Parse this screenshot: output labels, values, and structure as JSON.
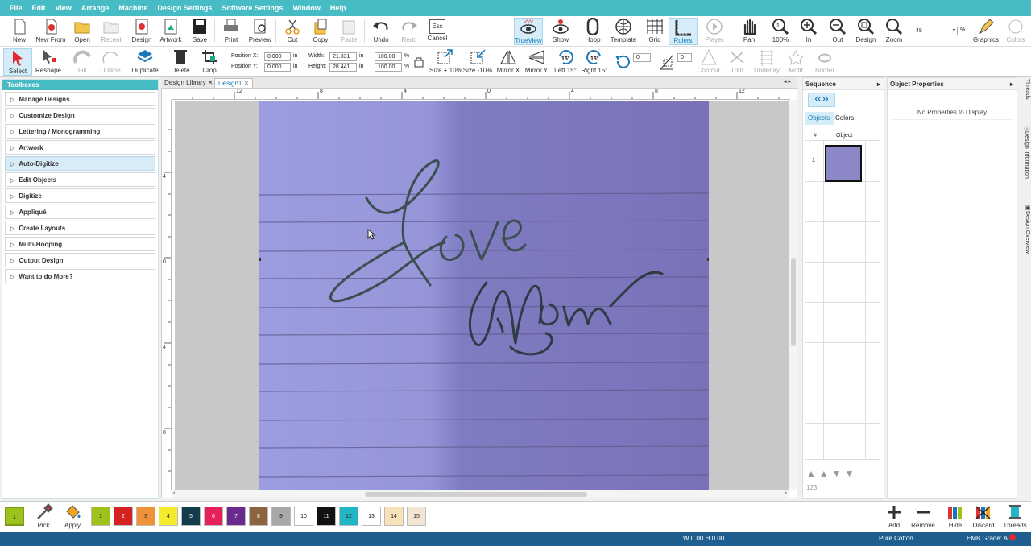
{
  "menu": [
    "File",
    "Edit",
    "View",
    "Arrange",
    "Machine",
    "Design Settings",
    "Software Settings",
    "Window",
    "Help"
  ],
  "toolbar1": {
    "new": "New",
    "new_from": "New From",
    "open": "Open",
    "recent": "Recent",
    "design": "Design",
    "artwork": "Artwork",
    "save": "Save",
    "print": "Print",
    "preview": "Preview",
    "cut": "Cut",
    "copy": "Copy",
    "paste": "Paste",
    "undo": "Undo",
    "redo": "Redo",
    "cancel": "Cancel",
    "esc": "Esc",
    "trueview": "TrueView",
    "show": "Show",
    "hoop": "Hoop",
    "template": "Template",
    "grid": "Grid",
    "rulers": "Rulers",
    "player": "Player",
    "pan": "Pan",
    "zoom100": "100%",
    "zoom_in": "In",
    "zoom_out": "Out",
    "zoom_design": "Design",
    "zoom": "Zoom",
    "zoom_value": "48",
    "percent": "%",
    "graphics": "Graphics",
    "colors": "Colors"
  },
  "toolbar2": {
    "select": "Select",
    "reshape": "Reshape",
    "fill": "Fill",
    "outline": "Outline",
    "duplicate": "Duplicate",
    "delete": "Delete",
    "crop": "Crop",
    "pos_x_label": "Position X:",
    "pos_x": "0.000",
    "pos_y_label": "Position Y:",
    "pos_y": "0.000",
    "unit": "in",
    "width_label": "Width:",
    "width": "21.331",
    "height_label": "Height:",
    "height": "28.441",
    "scale_w": "100.00",
    "scale_h": "100.00",
    "pct": "%",
    "size_plus": "Size + 10%",
    "size_minus": "Size -10%",
    "mirror_x": "Mirror X",
    "mirror_y": "Mirror Y",
    "left15": "Left 15°",
    "right15": "Right 15°",
    "deg": "15°",
    "rotate_val": "0",
    "slant_val": "0",
    "contour": "Contour",
    "trim": "Trim",
    "underlay": "Underlay",
    "motif": "Motif",
    "border": "Border"
  },
  "toolboxes": {
    "title": "Toolboxes",
    "items": [
      "Manage Designs",
      "Customize Design",
      "Lettering / Monogramming",
      "Artwork",
      "Auto-Digitize",
      "Edit Objects",
      "Digitize",
      "Appliqué",
      "Create Layouts",
      "Multi-Hooping",
      "Output Design",
      "Want to do More?"
    ]
  },
  "tabs": {
    "library": "Design Library",
    "design1": "Design1"
  },
  "rulers": {
    "h": [
      "12",
      "8",
      "4",
      "0",
      "4",
      "8",
      "12"
    ],
    "v": [
      "4",
      "0",
      "4",
      "8"
    ]
  },
  "handwriting": {
    "line1": "Love",
    "line2": "Mom"
  },
  "sequence": {
    "title": "Sequence",
    "tab_objects": "Objects",
    "tab_colors": "Colors",
    "col_num": "#",
    "col_object": "Object",
    "row1": "1",
    "footer": "123"
  },
  "object_properties": {
    "title": "Object Properties",
    "empty": "No Properties to Display"
  },
  "side_tabs": {
    "threads": "Threads",
    "design_info": "Design Information",
    "design_overview": "Design Overview"
  },
  "palette": {
    "pick": "Pick",
    "apply": "Apply",
    "current": "1",
    "swatches": [
      {
        "n": "1",
        "c": "#9dc11d"
      },
      {
        "n": "2",
        "c": "#d42121"
      },
      {
        "n": "3",
        "c": "#f0923a"
      },
      {
        "n": "4",
        "c": "#f2ec2c"
      },
      {
        "n": "5",
        "c": "#143b4c"
      },
      {
        "n": "6",
        "c": "#e8205a"
      },
      {
        "n": "7",
        "c": "#6a2b8f"
      },
      {
        "n": "8",
        "c": "#8c6440"
      },
      {
        "n": "9",
        "c": "#a8a8a8"
      },
      {
        "n": "10",
        "c": "#ffffff"
      },
      {
        "n": "11",
        "c": "#111111"
      },
      {
        "n": "12",
        "c": "#22b6c4"
      },
      {
        "n": "13",
        "c": "#ffffff"
      },
      {
        "n": "14",
        "c": "#f8e2b8"
      },
      {
        "n": "15",
        "c": "#f4e4d4"
      }
    ]
  },
  "thread_actions": {
    "add": "Add",
    "remove": "Remove",
    "hide": "Hide",
    "discard": "Discard",
    "threads": "Threads"
  },
  "status": {
    "wh": "W 0.00 H 0.00",
    "fabric": "Pure Cotton",
    "grade": "EMB Grade: A"
  },
  "colors": {
    "accent": "#48bcc4",
    "status_bar": "#1f5f8f",
    "paper": "#8f8fd0"
  }
}
